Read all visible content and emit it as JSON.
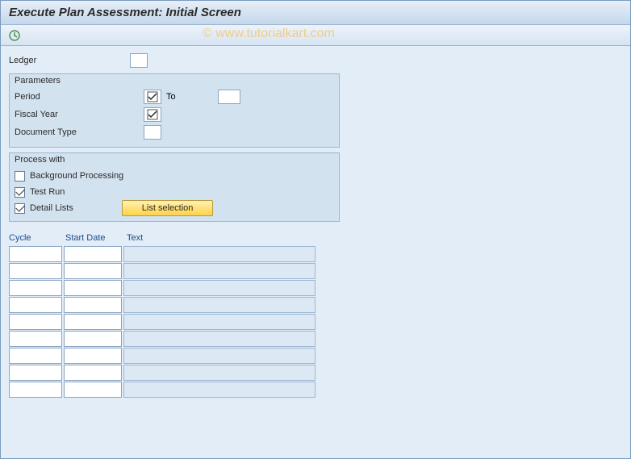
{
  "title": "Execute Plan Assessment: Initial Screen",
  "watermark": "© www.tutorialkart.com",
  "ledger": {
    "label": "Ledger",
    "value": ""
  },
  "parameters": {
    "title": "Parameters",
    "period": {
      "label": "Period",
      "from": "",
      "to_label": "To",
      "to": ""
    },
    "fiscal_year": {
      "label": "Fiscal Year",
      "value": ""
    },
    "doc_type": {
      "label": "Document Type",
      "value": ""
    }
  },
  "process": {
    "title": "Process with",
    "bg": {
      "label": "Background Processing",
      "checked": false
    },
    "test": {
      "label": "Test Run",
      "checked": true
    },
    "detail": {
      "label": "Detail Lists",
      "checked": true
    },
    "list_btn": "List selection"
  },
  "table": {
    "headers": {
      "cycle": "Cycle",
      "start": "Start Date",
      "text": "Text"
    },
    "rows": [
      {
        "cycle": "",
        "start": "",
        "text": ""
      },
      {
        "cycle": "",
        "start": "",
        "text": ""
      },
      {
        "cycle": "",
        "start": "",
        "text": ""
      },
      {
        "cycle": "",
        "start": "",
        "text": ""
      },
      {
        "cycle": "",
        "start": "",
        "text": ""
      },
      {
        "cycle": "",
        "start": "",
        "text": ""
      },
      {
        "cycle": "",
        "start": "",
        "text": ""
      },
      {
        "cycle": "",
        "start": "",
        "text": ""
      },
      {
        "cycle": "",
        "start": "",
        "text": ""
      }
    ]
  }
}
